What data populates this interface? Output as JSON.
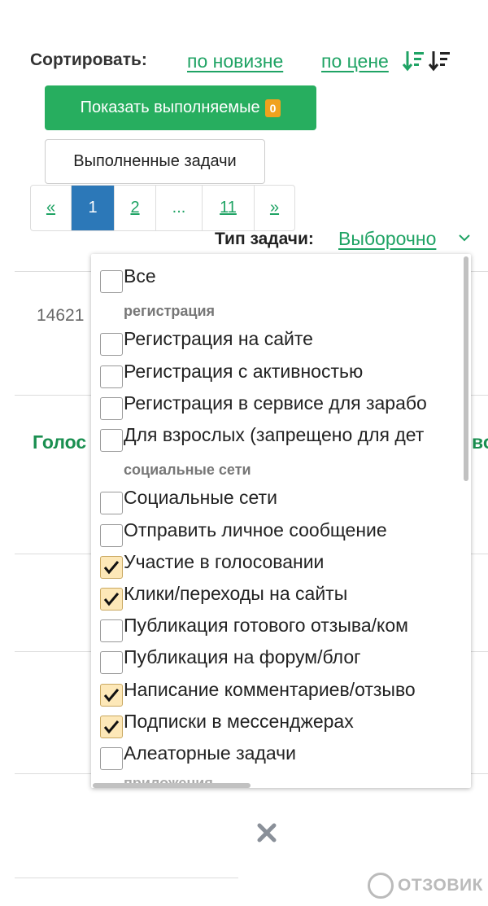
{
  "sort": {
    "label": "Сортировать:",
    "by_newness": "по новизне",
    "by_price": "по цене"
  },
  "buttons": {
    "show_in_progress": "Показать выполняемые",
    "in_progress_count": "0",
    "completed_tasks": "Выполненные задачи"
  },
  "pagination": {
    "prev": "«",
    "pages": [
      "1",
      "2",
      "...",
      "11"
    ],
    "next": "»",
    "current": "1"
  },
  "task_type": {
    "label": "Тип задачи:",
    "value": "Выборочно"
  },
  "background": {
    "task_number": "14621",
    "task_title_fragment_left": "Голос",
    "task_title_fragment_right": "во"
  },
  "dropdown": {
    "all": {
      "label": "Все",
      "checked": false
    },
    "groups": [
      {
        "name": "регистрация",
        "items": [
          {
            "label": "Регистрация на сайте",
            "checked": false
          },
          {
            "label": "Регистрация с активностью",
            "checked": false
          },
          {
            "label": "Регистрация в сервисе для зарабо",
            "checked": false
          },
          {
            "label": "Для взрослых (запрещено для дет",
            "checked": false
          }
        ]
      },
      {
        "name": "социальные сети",
        "items": [
          {
            "label": "Социальные сети",
            "checked": false
          },
          {
            "label": "Отправить личное сообщение",
            "checked": false
          },
          {
            "label": "Участие в голосовании",
            "checked": true
          },
          {
            "label": "Клики/переходы на сайты",
            "checked": true
          },
          {
            "label": "Публикация готового отзыва/ком",
            "checked": false
          },
          {
            "label": "Публикация на форум/блог",
            "checked": false
          },
          {
            "label": "Написание комментариев/отзыво",
            "checked": true
          },
          {
            "label": "Подписки в мессенджерах",
            "checked": true
          },
          {
            "label": "Алеаторные задачи",
            "checked": false
          }
        ]
      }
    ],
    "cut_group": "приложения"
  },
  "watermark": "ОТЗОВИК",
  "icons": {
    "sort_asc": "sort-ascending-icon",
    "sort_desc": "sort-descending-icon",
    "chevron": "chevron-down-icon",
    "close": "close-icon",
    "check": "check-icon"
  },
  "colors": {
    "link_green": "#1fa364",
    "button_green": "#27ae5f",
    "badge_orange": "#f0a21e",
    "active_page_blue": "#2c78b8",
    "checked_bg": "#fde8b8"
  }
}
